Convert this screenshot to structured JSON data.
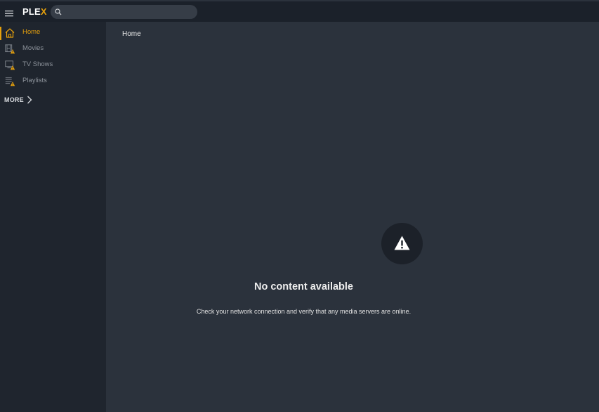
{
  "app": {
    "logo_text": "PLE",
    "logo_accent": "X",
    "accent_color": "#e5a00d"
  },
  "search": {
    "placeholder": "",
    "value": ""
  },
  "sidebar": {
    "items": [
      {
        "label": "Home",
        "icon": "home-icon",
        "active": true
      },
      {
        "label": "Movies",
        "icon": "film-icon",
        "warning": true
      },
      {
        "label": "TV Shows",
        "icon": "tv-icon",
        "warning": true
      },
      {
        "label": "Playlists",
        "icon": "playlist-icon",
        "warning": true
      }
    ],
    "more_label": "MORE"
  },
  "main": {
    "page_title": "Home",
    "empty_title": "No content available",
    "empty_message": "Check your network connection and verify that any media servers are online."
  }
}
